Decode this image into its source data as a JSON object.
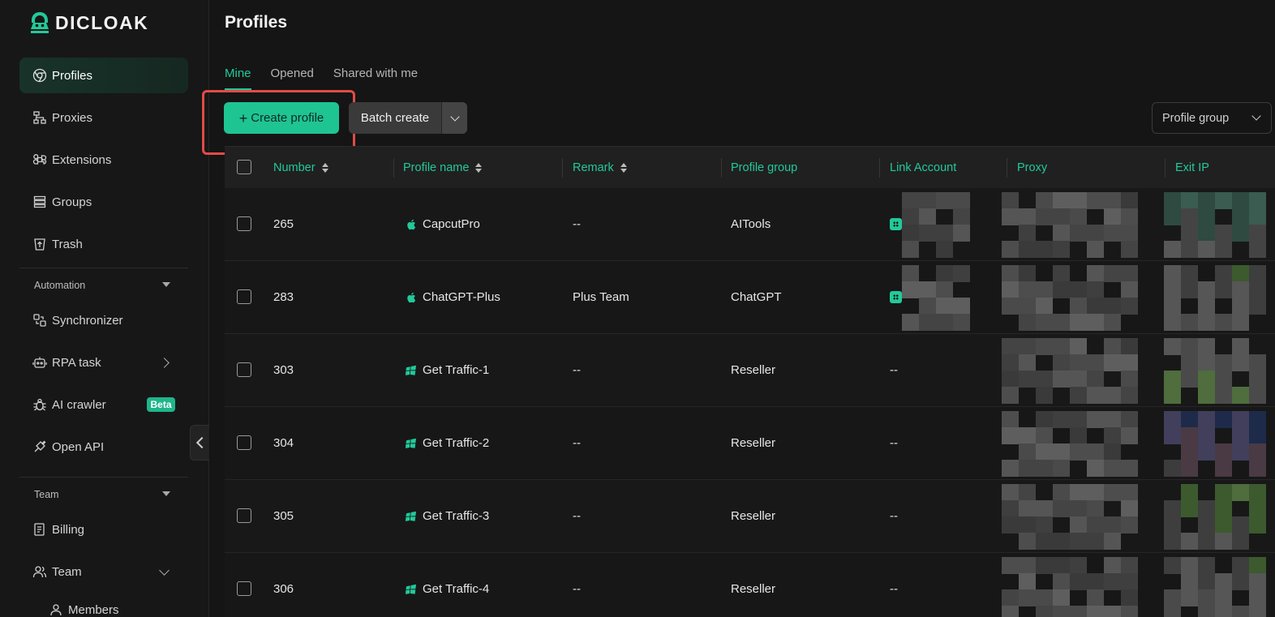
{
  "app": {
    "brand": "DICLOAK",
    "accent": "#22c99a"
  },
  "sidebar": {
    "items": [
      {
        "label": "Profiles",
        "icon": "chrome-icon"
      },
      {
        "label": "Proxies",
        "icon": "network-icon"
      },
      {
        "label": "Extensions",
        "icon": "command-icon"
      },
      {
        "label": "Groups",
        "icon": "layers-icon"
      },
      {
        "label": "Trash",
        "icon": "trash-icon"
      }
    ],
    "automation": {
      "title": "Automation",
      "items": [
        {
          "label": "Synchronizer",
          "icon": "sync-icon"
        },
        {
          "label": "RPA task",
          "icon": "robot-icon"
        },
        {
          "label": "AI crawler",
          "icon": "bug-icon",
          "badge": "Beta"
        },
        {
          "label": "Open API",
          "icon": "plug-icon"
        }
      ]
    },
    "team": {
      "title": "Team",
      "items": [
        {
          "label": "Billing",
          "icon": "billing-icon"
        },
        {
          "label": "Team",
          "icon": "users-icon"
        },
        {
          "label": "Members",
          "icon": "user-icon"
        }
      ]
    }
  },
  "main": {
    "title": "Profiles",
    "tabs": [
      "Mine",
      "Opened",
      "Shared with me"
    ],
    "create_label": "Create profile",
    "batch_label": "Batch create",
    "group_select_placeholder": "Profile group"
  },
  "table": {
    "headers": [
      "Number",
      "Profile name",
      "Remark",
      "Profile group",
      "Link Account",
      "Proxy",
      "Exit IP"
    ],
    "rows": [
      {
        "number": "265",
        "os": "apple-icon",
        "name": "CapcutPro",
        "remark": "--",
        "group": "AITools",
        "link": ""
      },
      {
        "number": "283",
        "os": "apple-icon",
        "name": "ChatGPT-Plus",
        "remark": "Plus Team",
        "group": "ChatGPT",
        "link": ""
      },
      {
        "number": "303",
        "os": "windows-icon",
        "name": "Get Traffic-1",
        "remark": "--",
        "group": "Reseller",
        "link": "--"
      },
      {
        "number": "304",
        "os": "windows-icon",
        "name": "Get Traffic-2",
        "remark": "--",
        "group": "Reseller",
        "link": "--"
      },
      {
        "number": "305",
        "os": "windows-icon",
        "name": "Get Traffic-3",
        "remark": "--",
        "group": "Reseller",
        "link": "--"
      },
      {
        "number": "306",
        "os": "windows-icon",
        "name": "Get Traffic-4",
        "remark": "--",
        "group": "Reseller",
        "link": "--"
      }
    ]
  }
}
